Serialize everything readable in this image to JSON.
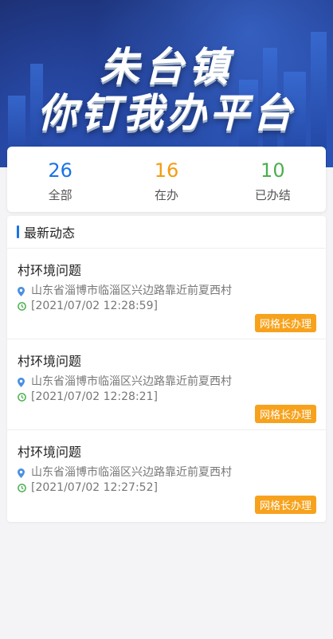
{
  "banner": {
    "line1": "朱台镇",
    "line2": "你钉我办平台"
  },
  "stats": [
    {
      "value": "26",
      "label": "全部",
      "color": "#1a73e8"
    },
    {
      "value": "16",
      "label": "在办",
      "color": "#f39c12"
    },
    {
      "value": "10",
      "label": "已办结",
      "color": "#4caf50"
    }
  ],
  "feed": {
    "heading": "最新动态",
    "items": [
      {
        "title": "村环境问题",
        "address": "山东省淄博市临淄区兴边路靠近前夏西村",
        "time": "[2021/07/02 12:28:59]",
        "tag": "网格长办理"
      },
      {
        "title": "村环境问题",
        "address": "山东省淄博市临淄区兴边路靠近前夏西村",
        "time": "[2021/07/02 12:28:21]",
        "tag": "网格长办理"
      },
      {
        "title": "村环境问题",
        "address": "山东省淄博市临淄区兴边路靠近前夏西村",
        "time": "[2021/07/02 12:27:52]",
        "tag": "网格长办理"
      }
    ]
  },
  "icons": {
    "location": "location-pin-icon",
    "time": "clock-icon"
  }
}
